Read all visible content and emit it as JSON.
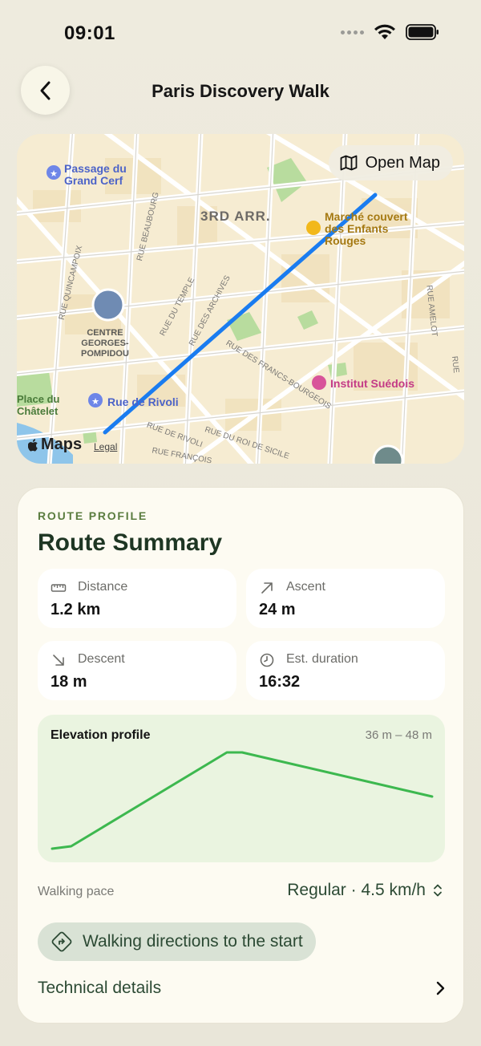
{
  "status_bar": {
    "time": "09:01"
  },
  "nav": {
    "title": "Paris Discovery Walk"
  },
  "map": {
    "open_map_label": "Open Map",
    "district_label": "3RD ARR.",
    "places": {
      "passage_du_grand_cerf": "Passage du\nGrand Cerf",
      "marche_couvert": "Marché couvert\ndes Enfants\nRouges",
      "centre_pompidou": "CENTRE\nGEORGES-\nPOMPIDOU",
      "place_du_chatelet": "Place du\nChâtelet",
      "rue_de_rivoli_poi": "Rue de Rivoli",
      "institut_suedois": "Institut Suédois"
    },
    "streets": {
      "rue_beaubourg": "RUE BEAUBOURG",
      "rue_quincampoix": "RUE QUINCAMPOIX",
      "rue_du_temple": "RUE DU TEMPLE",
      "rue_des_archives": "RUE DES ARCHIVES",
      "rue_des_francs_bourgeois": "RUE DES FRANCS-BOURGEOIS",
      "rue_de_rivoli": "RUE DE RIVOLI",
      "rue_du_roi_de_sicile": "RUE DU ROI DE SICILE",
      "rue_francois": "RUE FRANÇOIS",
      "rue_amelot": "RUE AMELOT",
      "rue_right": "RUE"
    },
    "maps_logo": "Maps",
    "legal": "Legal",
    "route_color": "#1a7cf0"
  },
  "summary": {
    "eyebrow": "ROUTE PROFILE",
    "title": "Route Summary",
    "stats": {
      "distance": {
        "label": "Distance",
        "value": "1.2 km",
        "icon": "ruler-icon"
      },
      "ascent": {
        "label": "Ascent",
        "value": "24 m",
        "icon": "arrow-up-right-icon"
      },
      "descent": {
        "label": "Descent",
        "value": "18 m",
        "icon": "arrow-down-right-icon"
      },
      "duration": {
        "label": "Est. duration",
        "value": "16:32",
        "icon": "clock-icon"
      }
    },
    "elevation": {
      "title": "Elevation profile",
      "range": "36 m – 48 m",
      "line_color": "#3db84f",
      "profile_points": [
        [
          0,
          36
        ],
        [
          0.05,
          36.3
        ],
        [
          0.46,
          48
        ],
        [
          0.5,
          48
        ],
        [
          1,
          42.5
        ]
      ]
    },
    "pace": {
      "label": "Walking pace",
      "value": "Regular · 4.5 km/h"
    },
    "directions_label": "Walking directions to the start",
    "tech_details_label": "Technical details"
  }
}
